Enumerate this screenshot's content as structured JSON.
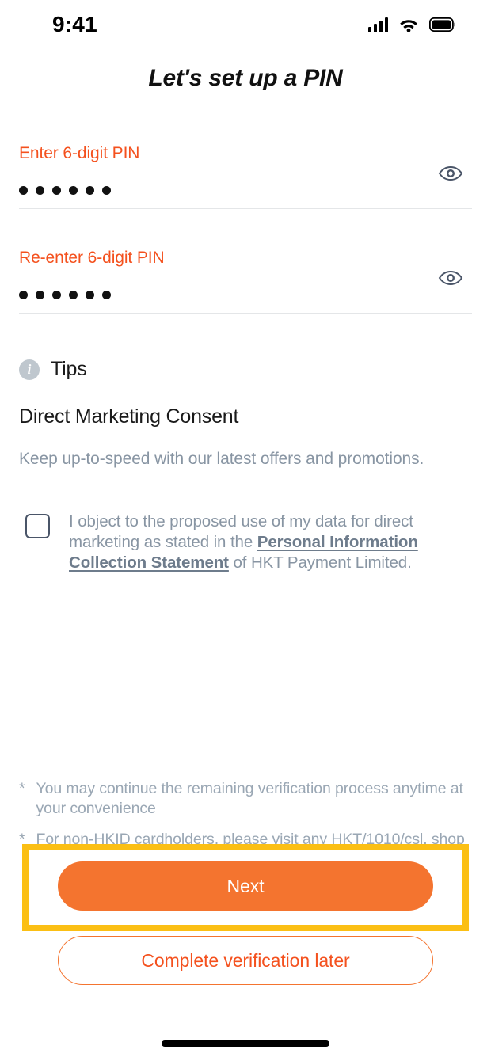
{
  "status_bar": {
    "time": "9:41",
    "cellular_icon": "cellular-signal-icon",
    "wifi_icon": "wifi-icon",
    "battery_icon": "battery-full-icon"
  },
  "header": {
    "title": "Let's set up a PIN"
  },
  "pin_fields": [
    {
      "label": "Enter 6-digit PIN",
      "value_masked": "••••••",
      "digits": 6,
      "toggle_icon": "eye-icon"
    },
    {
      "label": "Re-enter 6-digit PIN",
      "value_masked": "••••••",
      "digits": 6,
      "toggle_icon": "eye-icon"
    }
  ],
  "tips": {
    "icon": "info-icon",
    "icon_glyph": "i",
    "label": "Tips"
  },
  "consent": {
    "title": "Direct Marketing Consent",
    "subtitle": "Keep up-to-speed with our latest offers and promotions.",
    "checkbox_checked": false,
    "text_before": "I object to the proposed use of my data for direct marketing as stated in the ",
    "link_text": "Personal Information Collection Statement",
    "text_after": " of HKT Payment Limited."
  },
  "footnotes": [
    {
      "marker": "*",
      "text": "You may continue the remaining verification process anytime at your convenience"
    },
    {
      "marker": "*",
      "text": "For non-HKID cardholders, please visit any HKT/1010/csl. shop"
    }
  ],
  "actions": {
    "primary_label": "Next",
    "secondary_label": "Complete verification later"
  },
  "colors": {
    "accent_orange": "#F4511E",
    "button_orange": "#F4742F",
    "highlight_yellow": "#FBBF14",
    "muted_text": "#8895A3",
    "icon_slate": "#4A5568"
  }
}
